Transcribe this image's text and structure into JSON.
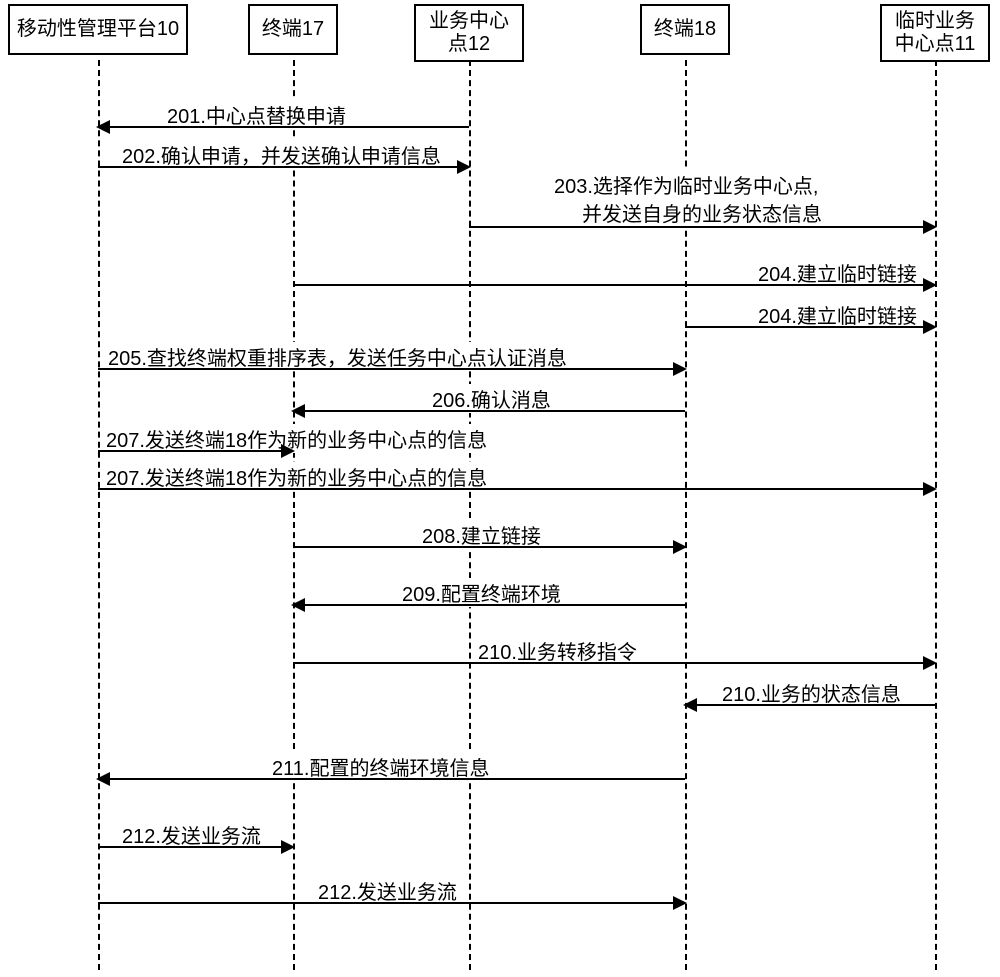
{
  "participants": {
    "mmp": "移动性管理平台10",
    "t17": "终端17",
    "sc12_l1": "业务中心",
    "sc12_l2": "点12",
    "t18": "终端18",
    "tmp11_l1": "临时业务",
    "tmp11_l2": "中心点11"
  },
  "messages": {
    "m201": "201.中心点替换申请",
    "m202": "202.确认申请，并发送确认申请信息",
    "m203a": "203.选择作为临时业务中心点,",
    "m203b": "并发送自身的业务状态信息",
    "m204a": "204.建立临时链接",
    "m204b": "204.建立临时链接",
    "m205": "205.查找终端权重排序表，发送任务中心点认证消息",
    "m206": "206.确认消息",
    "m207a": "207.发送终端18作为新的业务中心点的信息",
    "m207b": "207.发送终端18作为新的业务中心点的信息",
    "m208": "208.建立链接",
    "m209": "209.配置终端环境",
    "m210a": "210.业务转移指令",
    "m210b": "210.业务的状态信息",
    "m211": "211.配置的终端环境信息",
    "m212a": "212.发送业务流",
    "m212b": "212.发送业务流"
  },
  "chart_data": {
    "type": "sequence-diagram",
    "participants": [
      {
        "id": "mmp",
        "label": "移动性管理平台10"
      },
      {
        "id": "t17",
        "label": "终端17"
      },
      {
        "id": "sc12",
        "label": "业务中心点12"
      },
      {
        "id": "t18",
        "label": "终端18"
      },
      {
        "id": "tmp11",
        "label": "临时业务中心点11"
      }
    ],
    "messages": [
      {
        "step": "201",
        "from": "sc12",
        "to": "mmp",
        "text": "中心点替换申请"
      },
      {
        "step": "202",
        "from": "mmp",
        "to": "sc12",
        "text": "确认申请，并发送确认申请信息"
      },
      {
        "step": "203",
        "from": "sc12",
        "to": "tmp11",
        "text": "选择作为临时业务中心点,并发送自身的业务状态信息"
      },
      {
        "step": "204",
        "from": "t17",
        "to": "tmp11",
        "text": "建立临时链接"
      },
      {
        "step": "204",
        "from": "t18",
        "to": "tmp11",
        "text": "建立临时链接"
      },
      {
        "step": "205",
        "from": "mmp",
        "to": "t18",
        "text": "查找终端权重排序表，发送任务中心点认证消息"
      },
      {
        "step": "206",
        "from": "t18",
        "to": "t17",
        "text": "确认消息"
      },
      {
        "step": "207",
        "from": "mmp",
        "to": "t17",
        "text": "发送终端18作为新的业务中心点的信息"
      },
      {
        "step": "207",
        "from": "mmp",
        "to": "tmp11",
        "text": "发送终端18作为新的业务中心点的信息"
      },
      {
        "step": "208",
        "from": "t17",
        "to": "t18",
        "text": "建立链接"
      },
      {
        "step": "209",
        "from": "t18",
        "to": "t17",
        "text": "配置终端环境"
      },
      {
        "step": "210",
        "from": "t17",
        "to": "tmp11",
        "text": "业务转移指令"
      },
      {
        "step": "210",
        "from": "tmp11",
        "to": "t18",
        "text": "业务的状态信息"
      },
      {
        "step": "211",
        "from": "t18",
        "to": "mmp",
        "text": "配置的终端环境信息"
      },
      {
        "step": "212",
        "from": "mmp",
        "to": "t17",
        "text": "发送业务流"
      },
      {
        "step": "212",
        "from": "mmp",
        "to": "t18",
        "text": "发送业务流"
      }
    ]
  }
}
